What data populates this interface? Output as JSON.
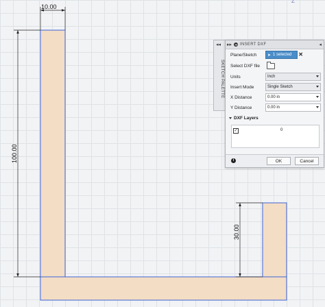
{
  "canvas": {
    "dimensions": {
      "top_width": "10.00",
      "left_height": "100.00",
      "right_height": "30.00"
    },
    "colors": {
      "fill": "#f3ddc5",
      "outline": "#3b63d6",
      "dimension": "#222222"
    }
  },
  "palette_tab": {
    "collapse_glyph": "◂◂",
    "label": "SKETCH PALETTE"
  },
  "panel": {
    "title": "INSERT DXF",
    "collapse_glyph": "▸▸",
    "expand_glyph": "◂",
    "fields": {
      "plane_label": "Plane/Sketch",
      "plane_value": "1 selected",
      "dxf_label": "Select DXF file",
      "units_label": "Units",
      "units_value": "Inch",
      "mode_label": "Insert Mode",
      "mode_value": "Single Sketch",
      "xdist_label": "X Distance",
      "xdist_value": "0.00 in",
      "ydist_label": "Y Distance",
      "ydist_value": "0.00 in"
    },
    "layers": {
      "header": "DXF Layers",
      "items": [
        {
          "checked": true,
          "name": "0"
        }
      ]
    },
    "footer": {
      "info_glyph": "i",
      "ok_label": "OK",
      "cancel_label": "Cancel"
    }
  },
  "icons": {
    "select": "cursor-icon",
    "clear": "close-icon",
    "file": "folder-open-icon",
    "info": "info-icon",
    "top_corner": "z-icon"
  }
}
